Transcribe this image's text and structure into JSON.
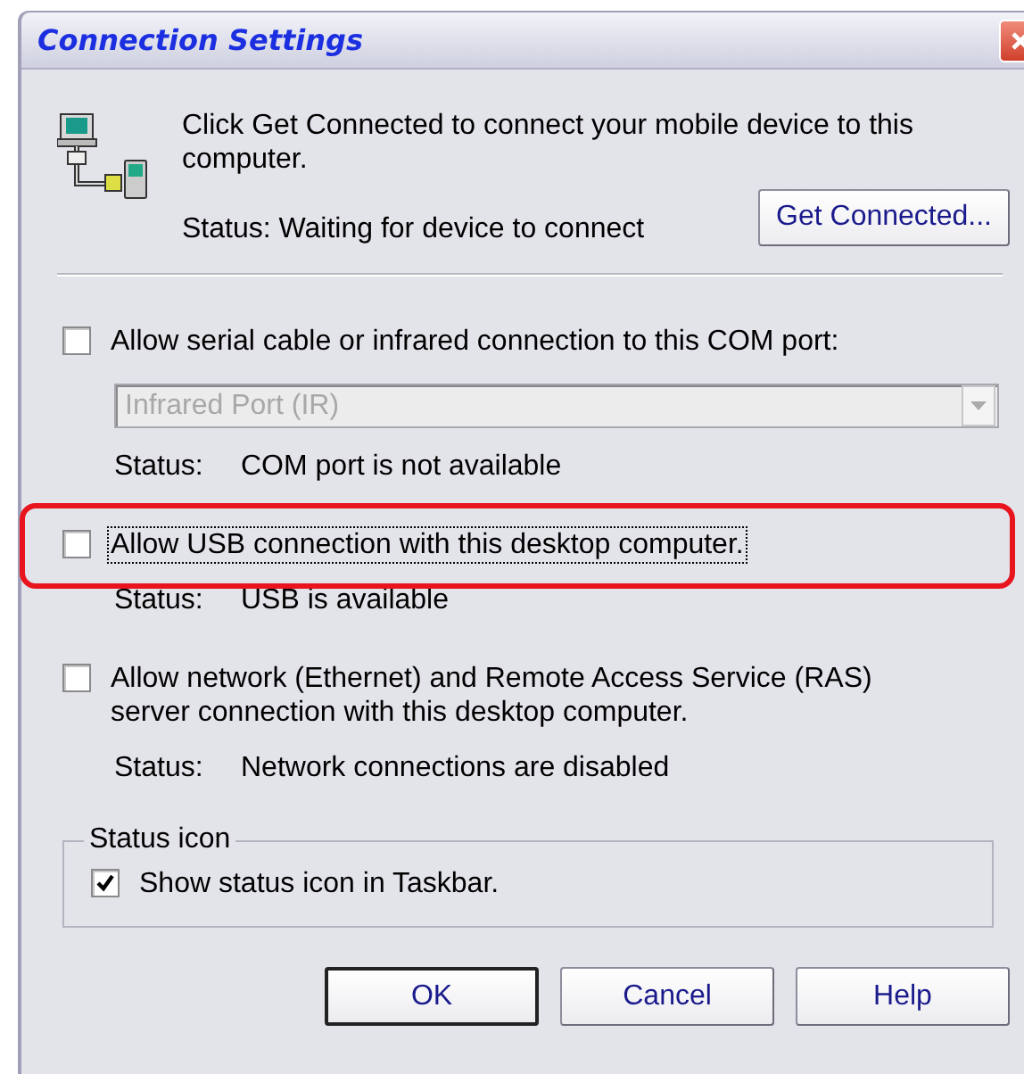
{
  "window": {
    "title": "Connection Settings"
  },
  "intro": {
    "text": "Click Get Connected to connect your mobile device to this computer.",
    "status": "Status: Waiting for device to connect",
    "button": "Get Connected..."
  },
  "options": [
    {
      "label": "Allow serial cable or infrared connection to this COM port:",
      "checked": false,
      "focused": false,
      "highlighted": false,
      "port": {
        "value": "Infrared Port (IR)",
        "disabled": true
      },
      "status_label": "Status:",
      "status": "COM port is not available"
    },
    {
      "label": "Allow USB connection with this desktop computer.",
      "checked": false,
      "focused": true,
      "highlighted": true,
      "status_label": "Status:",
      "status": "USB is available"
    },
    {
      "label": "Allow network (Ethernet) and Remote Access Service (RAS) server connection with this desktop computer.",
      "checked": false,
      "focused": false,
      "highlighted": false,
      "status_label": "Status:",
      "status": "Network connections are disabled"
    }
  ],
  "status_icon": {
    "legend": "Status icon",
    "label": "Show status icon in Taskbar.",
    "checked": true
  },
  "buttons": [
    {
      "label": "OK",
      "default": true
    },
    {
      "label": "Cancel",
      "default": false
    },
    {
      "label": "Help",
      "default": false
    }
  ]
}
